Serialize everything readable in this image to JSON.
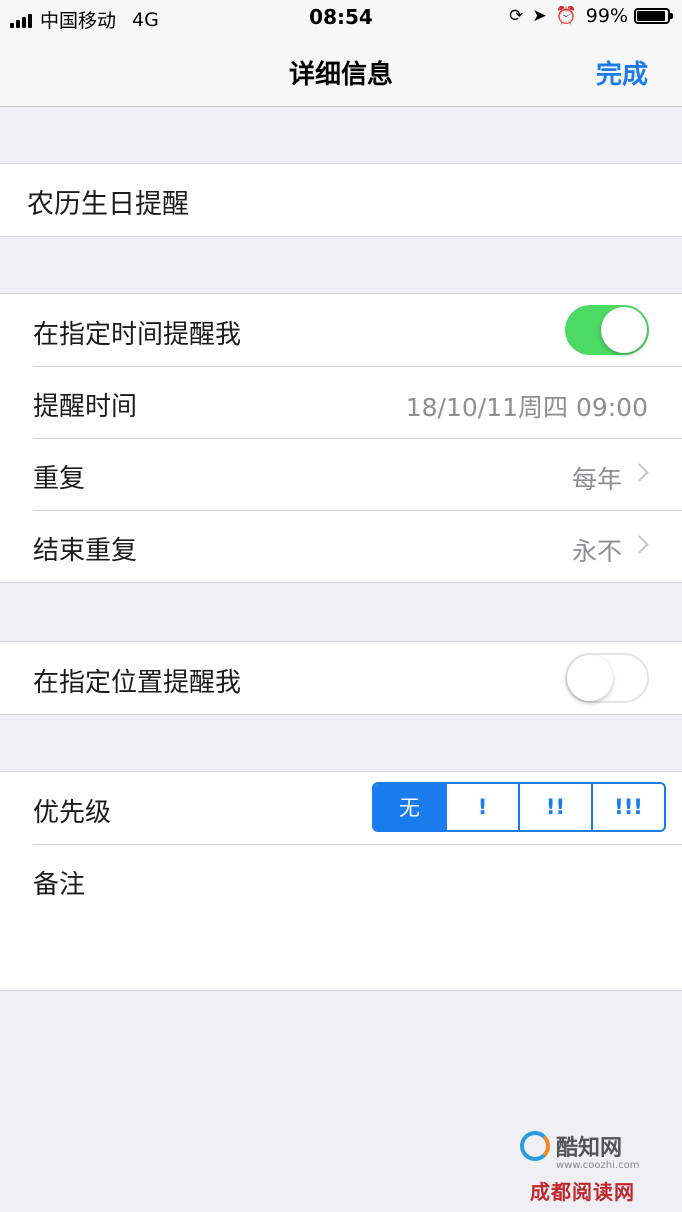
{
  "status_bar": {
    "carrier": "中国移动",
    "network": "4G",
    "time": "08:54",
    "battery": "99%",
    "battery_level": 0.99,
    "icons": [
      "signal-icon",
      "orientation-lock-icon",
      "location-icon",
      "alarm-icon",
      "battery-icon"
    ]
  },
  "nav": {
    "title": "详细信息",
    "done_label": "完成"
  },
  "reminder": {
    "title": "农历生日提醒"
  },
  "time_group": {
    "remind_at_time_label": "在指定时间提醒我",
    "remind_at_time_on": true,
    "remind_time_label": "提醒时间",
    "remind_time_value": "18/10/11周四 09:00",
    "repeat_label": "重复",
    "repeat_value": "每年",
    "end_repeat_label": "结束重复",
    "end_repeat_value": "永不"
  },
  "location_group": {
    "remind_at_location_label": "在指定位置提醒我",
    "remind_at_location_on": false
  },
  "priority_group": {
    "priority_label": "优先级",
    "options": [
      "无",
      "!",
      "!!",
      "!!!"
    ],
    "selected": "无",
    "notes_label": "备注"
  },
  "watermark": {
    "name": "酷知网",
    "url": "www.coozhi.com",
    "bottom": "成都阅读网"
  },
  "colors": {
    "accent": "#1a7bec",
    "toggle_on": "#4cd964",
    "background": "#efeff4"
  }
}
